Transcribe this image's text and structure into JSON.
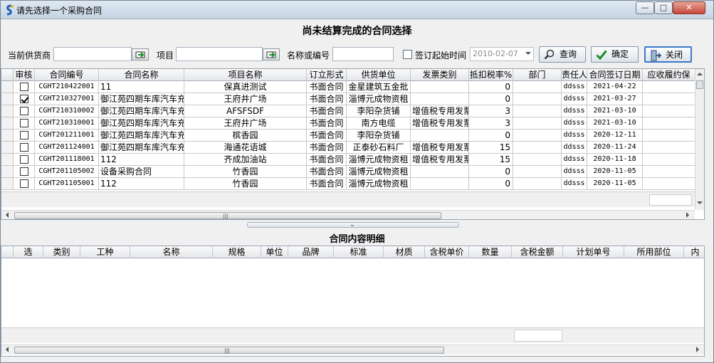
{
  "window": {
    "title": "请先选择一个采购合同",
    "minimize_glyph": "—",
    "maximize_glyph": "□",
    "close_glyph": "✕"
  },
  "header": {
    "title": "尚未结算完成的合同选择"
  },
  "toolbar": {
    "supplier_label": "当前供货商",
    "supplier_value": "",
    "project_label": "项目",
    "project_value": "",
    "name_code_label": "名称或编号",
    "name_code_value": "",
    "sign_start_label": "签订起始时间",
    "sign_start_checked": false,
    "sign_start_date": "2010-02-07",
    "query_label": "查询",
    "confirm_label": "确定",
    "close_label": "关闭"
  },
  "contracts": {
    "columns": [
      "审核",
      "合同编号",
      "合同名称",
      "项目名称",
      "订立形式",
      "供货单位",
      "发票类别",
      "抵扣税率%",
      "部门",
      "责任人",
      "合同签订日期",
      "应收履约保"
    ],
    "rows": [
      {
        "checked": false,
        "code": "CGHT210422001",
        "name": "11",
        "project": "保真进测试",
        "form": "书面合同",
        "supplier": "金星建筑五金批",
        "invoice": "",
        "tax": "0",
        "dept": "",
        "owner": "ddsss",
        "date": "2021-04-22"
      },
      {
        "checked": true,
        "code": "CGHT210327001",
        "name": "御江苑四期车库汽车充",
        "project": "王府井广场",
        "form": "书面合同",
        "supplier": "淄博元成物资租",
        "invoice": "",
        "tax": "0",
        "dept": "",
        "owner": "ddsss",
        "date": "2021-03-27"
      },
      {
        "checked": false,
        "code": "CGHT210310002",
        "name": "御江苑四期车库汽车充",
        "project": "AFSFSDF",
        "form": "书面合同",
        "supplier": "李阳杂货铺",
        "invoice": "增值税专用发票",
        "tax": "3",
        "dept": "",
        "owner": "ddsss",
        "date": "2021-03-10"
      },
      {
        "checked": false,
        "code": "CGHT210310001",
        "name": "御江苑四期车库汽车充",
        "project": "王府井广场",
        "form": "书面合同",
        "supplier": "南方电缆",
        "invoice": "增值税专用发票",
        "tax": "3",
        "dept": "",
        "owner": "ddsss",
        "date": "2021-03-10"
      },
      {
        "checked": false,
        "code": "CGHT201211001",
        "name": "御江苑四期车库汽车充",
        "project": "槟香园",
        "form": "书面合同",
        "supplier": "李阳杂货铺",
        "invoice": "",
        "tax": "0",
        "dept": "",
        "owner": "ddsss",
        "date": "2020-12-11"
      },
      {
        "checked": false,
        "code": "CGHT201124001",
        "name": "御江苑四期车库汽车充",
        "project": "海通花语城",
        "form": "书面合同",
        "supplier": "正泰砂石料厂",
        "invoice": "增值税专用发票",
        "tax": "15",
        "dept": "",
        "owner": "ddsss",
        "date": "2020-11-24"
      },
      {
        "checked": false,
        "code": "CGHT201118001",
        "name": "112",
        "project": "齐成加油站",
        "form": "书面合同",
        "supplier": "淄博元成物资租",
        "invoice": "增值税专用发票",
        "tax": "15",
        "dept": "",
        "owner": "ddsss",
        "date": "2020-11-18"
      },
      {
        "checked": false,
        "code": "CGHT201105002",
        "name": "设备采购合同",
        "project": "竹香园",
        "form": "书面合同",
        "supplier": "淄博元成物资租",
        "invoice": "",
        "tax": "0",
        "dept": "",
        "owner": "ddsss",
        "date": "2020-11-05"
      },
      {
        "checked": false,
        "code": "CGHT201105001",
        "name": "112",
        "project": "竹香园",
        "form": "书面合同",
        "supplier": "淄博元成物资租",
        "invoice": "",
        "tax": "0",
        "dept": "",
        "owner": "ddsss",
        "date": "2020-11-05"
      }
    ],
    "scroll_grip": "|||"
  },
  "detail": {
    "title": "合同内容明细",
    "columns": [
      "选",
      "类别",
      "工种",
      "名称",
      "规格",
      "单位",
      "品牌",
      "标准",
      "材质",
      "含税单价",
      "数量",
      "含税金额",
      "计划单号",
      "所用部位",
      "内"
    ],
    "scroll_grip": "|||"
  },
  "splitter": {
    "glyph": "⌄"
  },
  "colors": {
    "window_bg": "#f0f0f0",
    "accent": "#3a78c8",
    "confirm_check": "#1a8f2a"
  }
}
